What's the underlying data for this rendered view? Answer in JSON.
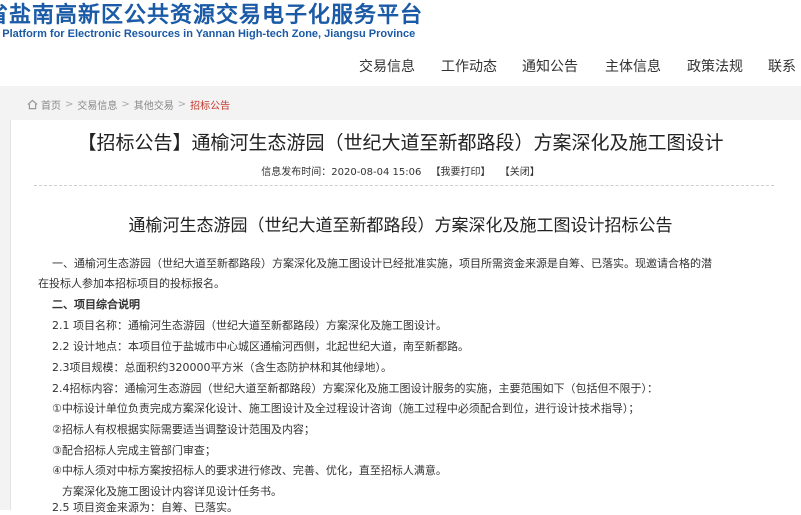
{
  "header": {
    "title": "省盐南高新区公共资源交易电子化服务平台",
    "subtitle": "al Platform for Electronic Resources in Yannan High-tech Zone, Jiangsu Province"
  },
  "nav": [
    {
      "label": "交易信息"
    },
    {
      "label": "工作动态"
    },
    {
      "label": "通知公告"
    },
    {
      "label": "主体信息"
    },
    {
      "label": "政策法规"
    },
    {
      "label": "联系"
    }
  ],
  "breadcrumb": [
    "首页",
    "交易信息",
    "其他交易",
    "招标公告"
  ],
  "article": {
    "title": "【招标公告】通榆河生态游园（世纪大道至新都路段）方案深化及施工图设计",
    "meta": {
      "date_label": "信息发布时间：2020-08-04 15:06",
      "print_label": "【我要打印】",
      "close_label": "【关闭】"
    },
    "doc_heading": "通榆河生态游园（世纪大道至新都路段）方案深化及施工图设计招标公告",
    "paragraphs": [
      "一、通榆河生态游园（世纪大道至新都路段）方案深化及施工图设计已经批准实施，项目所需资金来源是自筹、已落实。现邀请合格的潜",
      "在投标人参加本招标项目的投标报名。",
      "二、项目综合说明",
      "2.1 项目名称：通榆河生态游园（世纪大道至新都路段）方案深化及施工图设计。",
      "2.2 设计地点：本项目位于盐城市中心城区通榆河西侧，北起世纪大道，南至新都路。",
      "2.3项目规模：总面积约320000平方米（含生态防护林和其他绿地）。",
      "2.4招标内容：通榆河生态游园（世纪大道至新都路段）方案深化及施工图设计服务的实施，主要范围如下（包括但不限于）：",
      "①中标设计单位负责完成方案深化设计、施工图设计及全过程设计咨询（施工过程中必须配合到位，进行设计技术指导）；",
      "②招标人有权根据实际需要适当调整设计范围及内容；",
      "③配合招标人完成主管部门审查；",
      "④中标人须对中标方案按招标人的要求进行修改、完善、优化，直至招标人满意。",
      "方案深化及施工图设计内容详见设计任务书。",
      "2.5 项目资金来源为：自筹、已落实。"
    ]
  }
}
